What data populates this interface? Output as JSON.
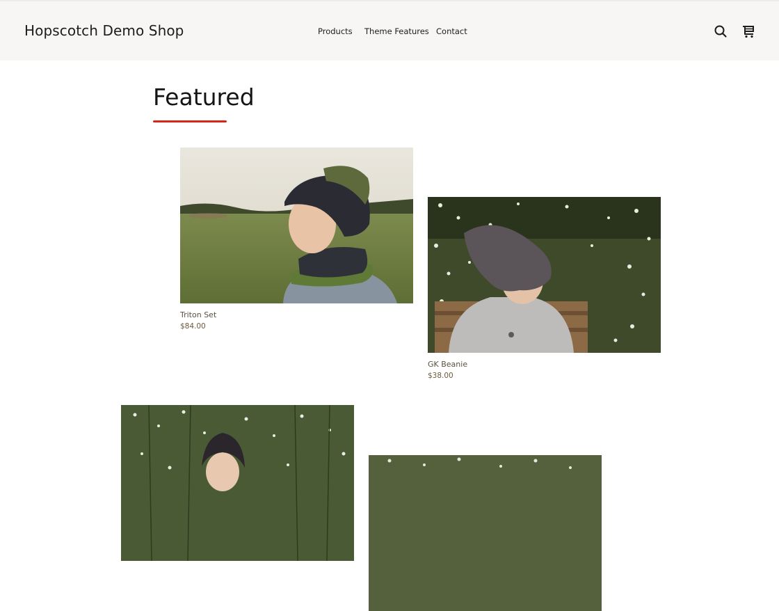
{
  "header": {
    "brand": "Hopscotch Demo Shop",
    "nav": [
      "Products",
      "Theme Features",
      "Contact"
    ],
    "icons": [
      "search-icon",
      "cart-icon"
    ]
  },
  "featured": {
    "title": "Featured",
    "accent_color": "#d6261c",
    "products": [
      {
        "name": "Triton Set",
        "price": "$84.00"
      },
      {
        "name": "GK Beanie",
        "price": "$38.00"
      }
    ]
  }
}
